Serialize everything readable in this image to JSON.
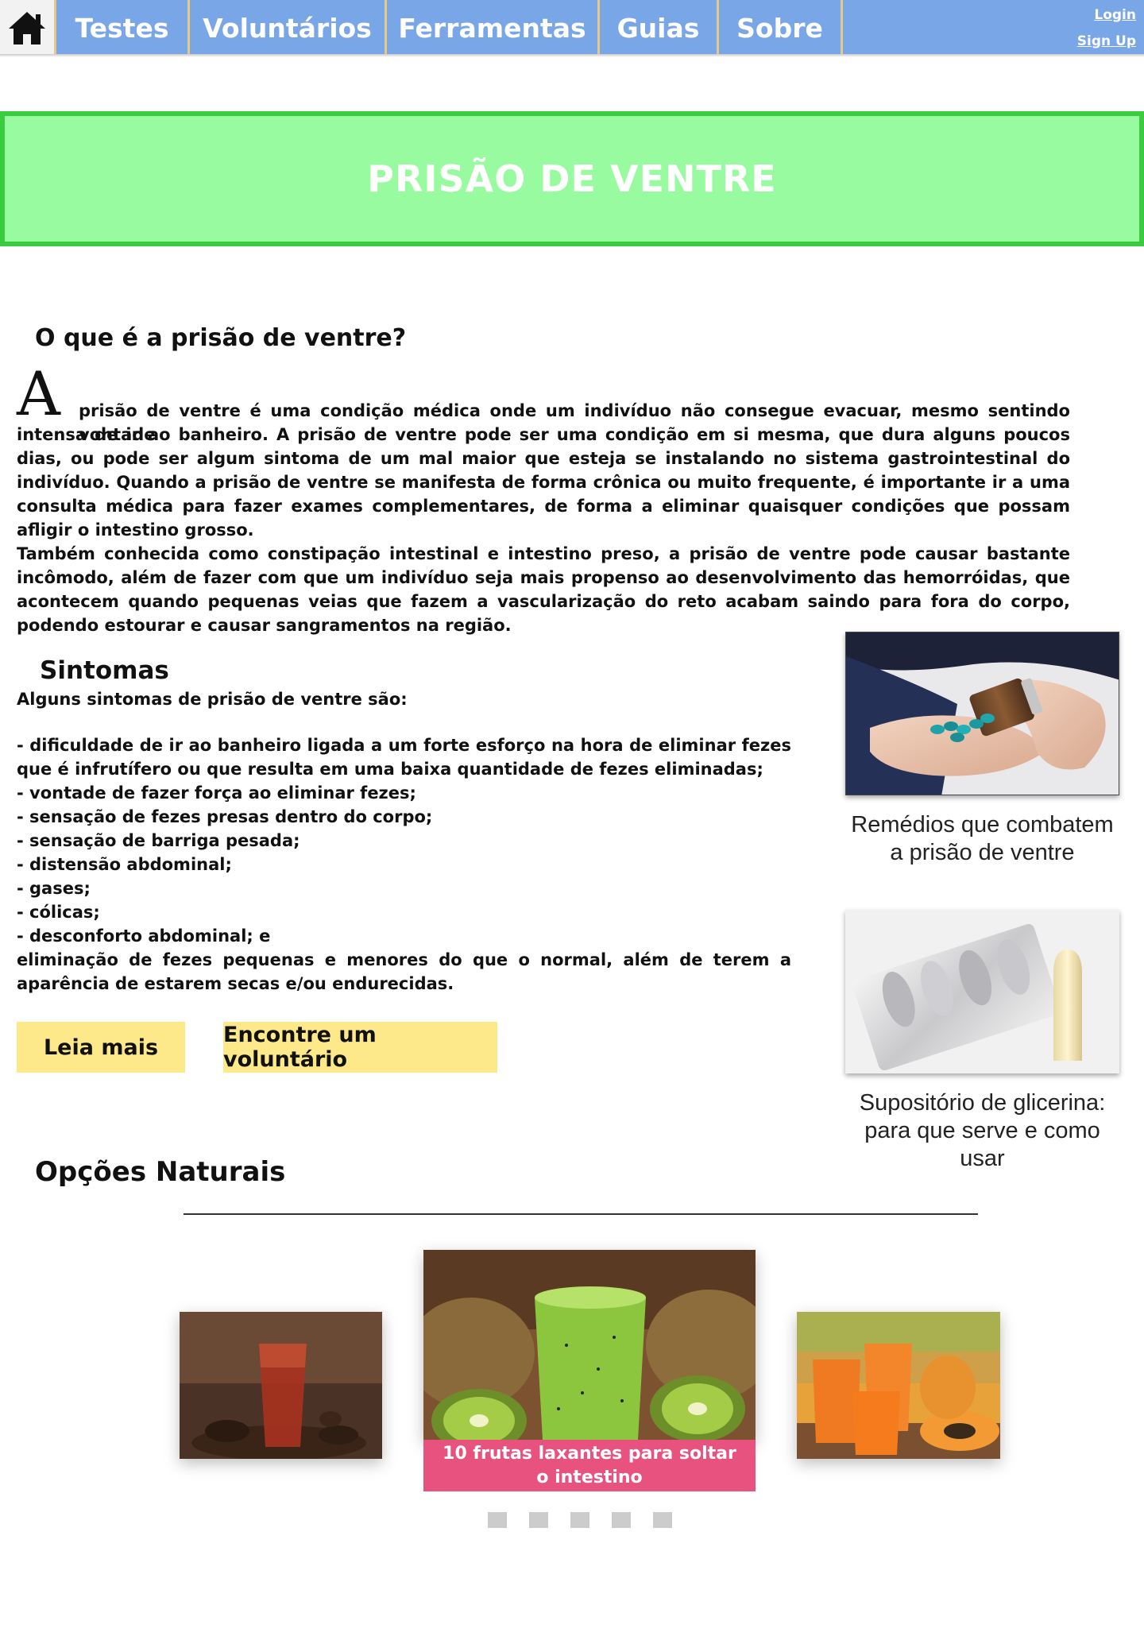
{
  "nav": {
    "home_icon": "home-icon",
    "items": [
      "Testes",
      "Voluntários",
      "Ferramentas",
      "Guias",
      "Sobre"
    ],
    "login": "Login",
    "signup": "Sign Up"
  },
  "banner": {
    "title": "PRISÃO DE VENTRE"
  },
  "intro": {
    "heading": "O que é a prisão de ventre?",
    "dropcap": "A",
    "paragraph1_first_line": "prisão de ventre é uma condição médica onde um indivíduo não consegue evacuar, mesmo sentindo vontade",
    "paragraph1_rest": "intensa de ir ao banheiro. A prisão de ventre pode ser uma condição em si mesma, que dura alguns poucos dias, ou pode ser algum sintoma de um mal maior que esteja se instalando no sistema gastrointestinal do indivíduo. Quando a prisão de ventre se manifesta de forma crônica ou muito frequente, é importante ir a uma consulta médica para fazer exames complementares, de forma a eliminar quaisquer condições que possam afligir o intestino grosso.",
    "paragraph2": "Também conhecida como constipação intestinal e intestino preso, a prisão de ventre pode causar bastante incômodo, além de fazer com que um indivíduo seja mais propenso ao desenvolvimento das hemorróidas, que acontecem quando pequenas veias que fazem a vascularização do reto acabam saindo para fora do corpo, podendo estourar e causar sangramentos na região."
  },
  "sintomas": {
    "heading": "Sintomas",
    "intro": "Alguns sintomas de prisão de ventre são:",
    "items": [
      "-  dificuldade de ir ao banheiro ligada a um forte esforço na hora de eliminar fezes que é infrutífero ou que resulta em uma baixa quantidade de fezes eliminadas;",
      "- vontade de fazer força ao eliminar fezes;",
      "- sensação de fezes presas dentro do corpo;",
      "- sensação de barriga pesada;",
      "- distensão abdominal;",
      "- gases;",
      "- cólicas;",
      "- desconforto abdominal; e",
      "eliminação de fezes pequenas e menores do que o normal, além de terem a aparência de estarem secas e/ou endurecidas."
    ]
  },
  "buttons": {
    "read_more": "Leia mais",
    "find_volunteer": "Encontre um voluntário"
  },
  "sidebar": {
    "card1_caption": "Remédios que combatem a prisão de ventre",
    "card2_caption": "Supositório de glicerina: para que serve e como usar"
  },
  "natural": {
    "heading": "Opções Naturais",
    "active_caption": "10 frutas laxantes para soltar o intestino",
    "dots_count": 5
  },
  "colors": {
    "nav_blue": "#79a6e6",
    "banner_green": "#98fb9f",
    "banner_border": "#3acc3f",
    "button_yellow": "#fde98a",
    "caption_pink": "#e8527e"
  }
}
